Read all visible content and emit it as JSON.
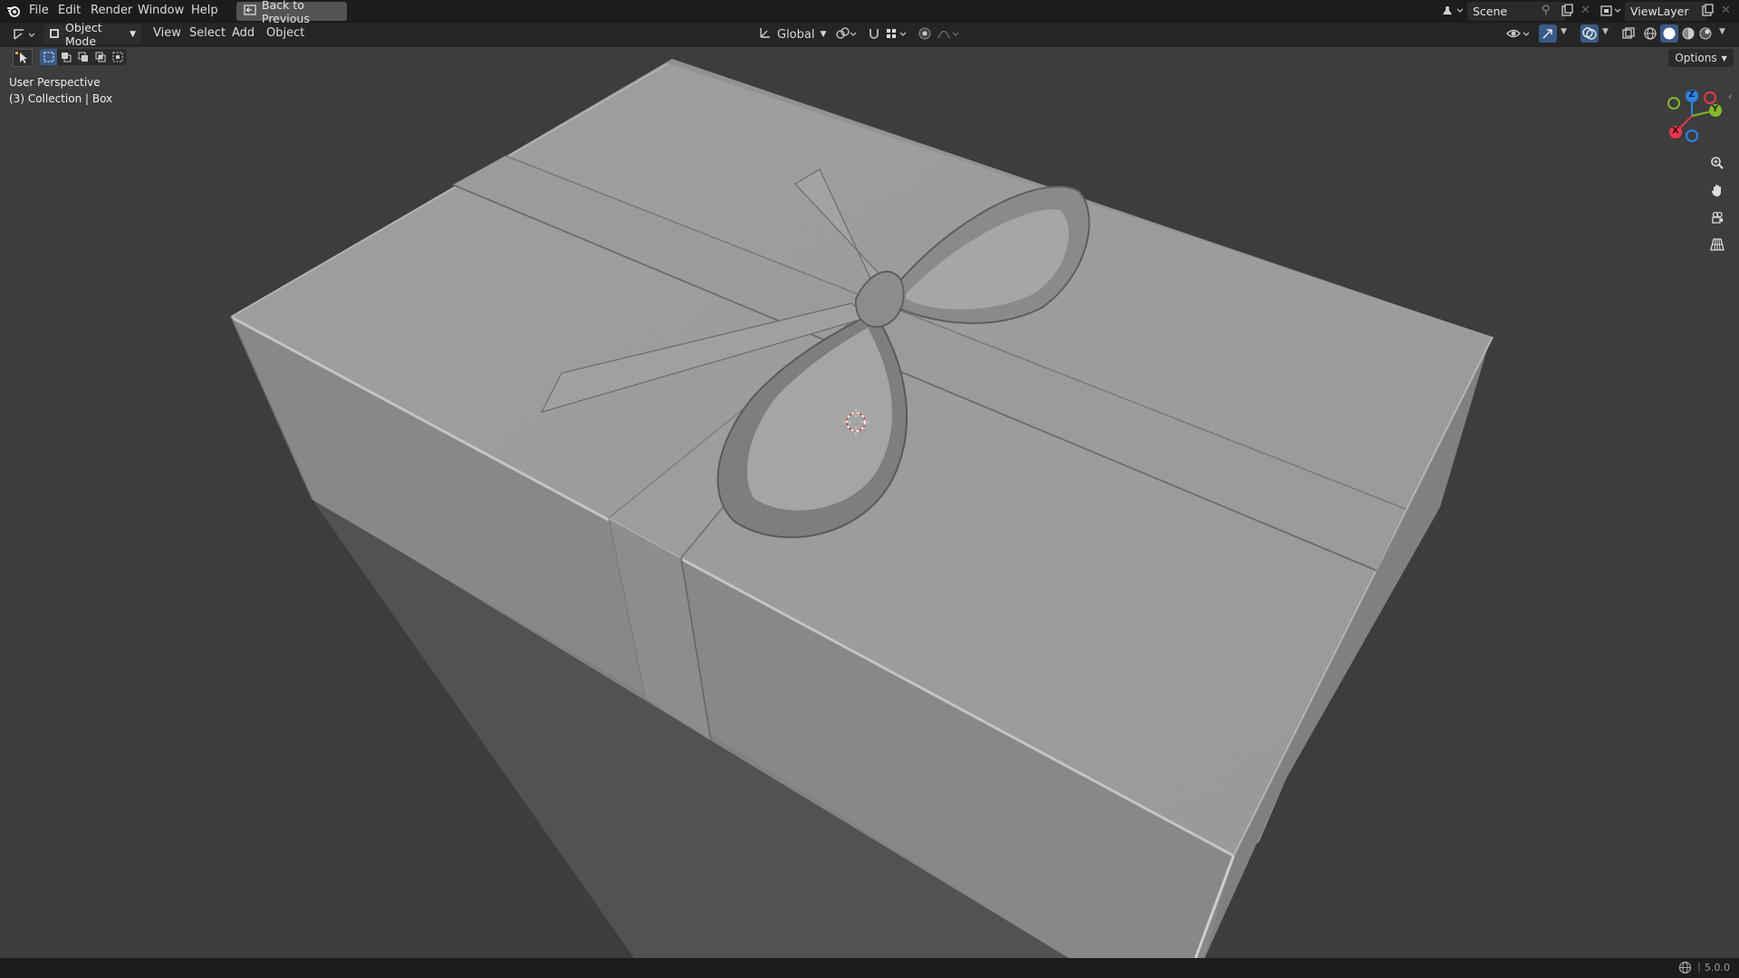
{
  "topbar": {
    "menu": [
      "File",
      "Edit",
      "Render",
      "Window",
      "Help"
    ],
    "back_button": "Back to Previous",
    "scene_value": "Scene",
    "viewlayer_value": "ViewLayer"
  },
  "header": {
    "mode": "Object Mode",
    "menus": [
      "View",
      "Select",
      "Add",
      "Object"
    ],
    "transform_orientation": "Global",
    "options_label": "Options"
  },
  "viewport": {
    "perspective_label": "User Perspective",
    "collection_label": "(3) Collection | Box",
    "gizmo_axes": {
      "x": "X",
      "y": "Y",
      "z": "Z"
    },
    "colors": {
      "x_axis": "#e8364a",
      "y_axis": "#86b62d",
      "z_axis": "#2f84e6"
    }
  },
  "statusbar": {
    "version": "5.0.0"
  }
}
